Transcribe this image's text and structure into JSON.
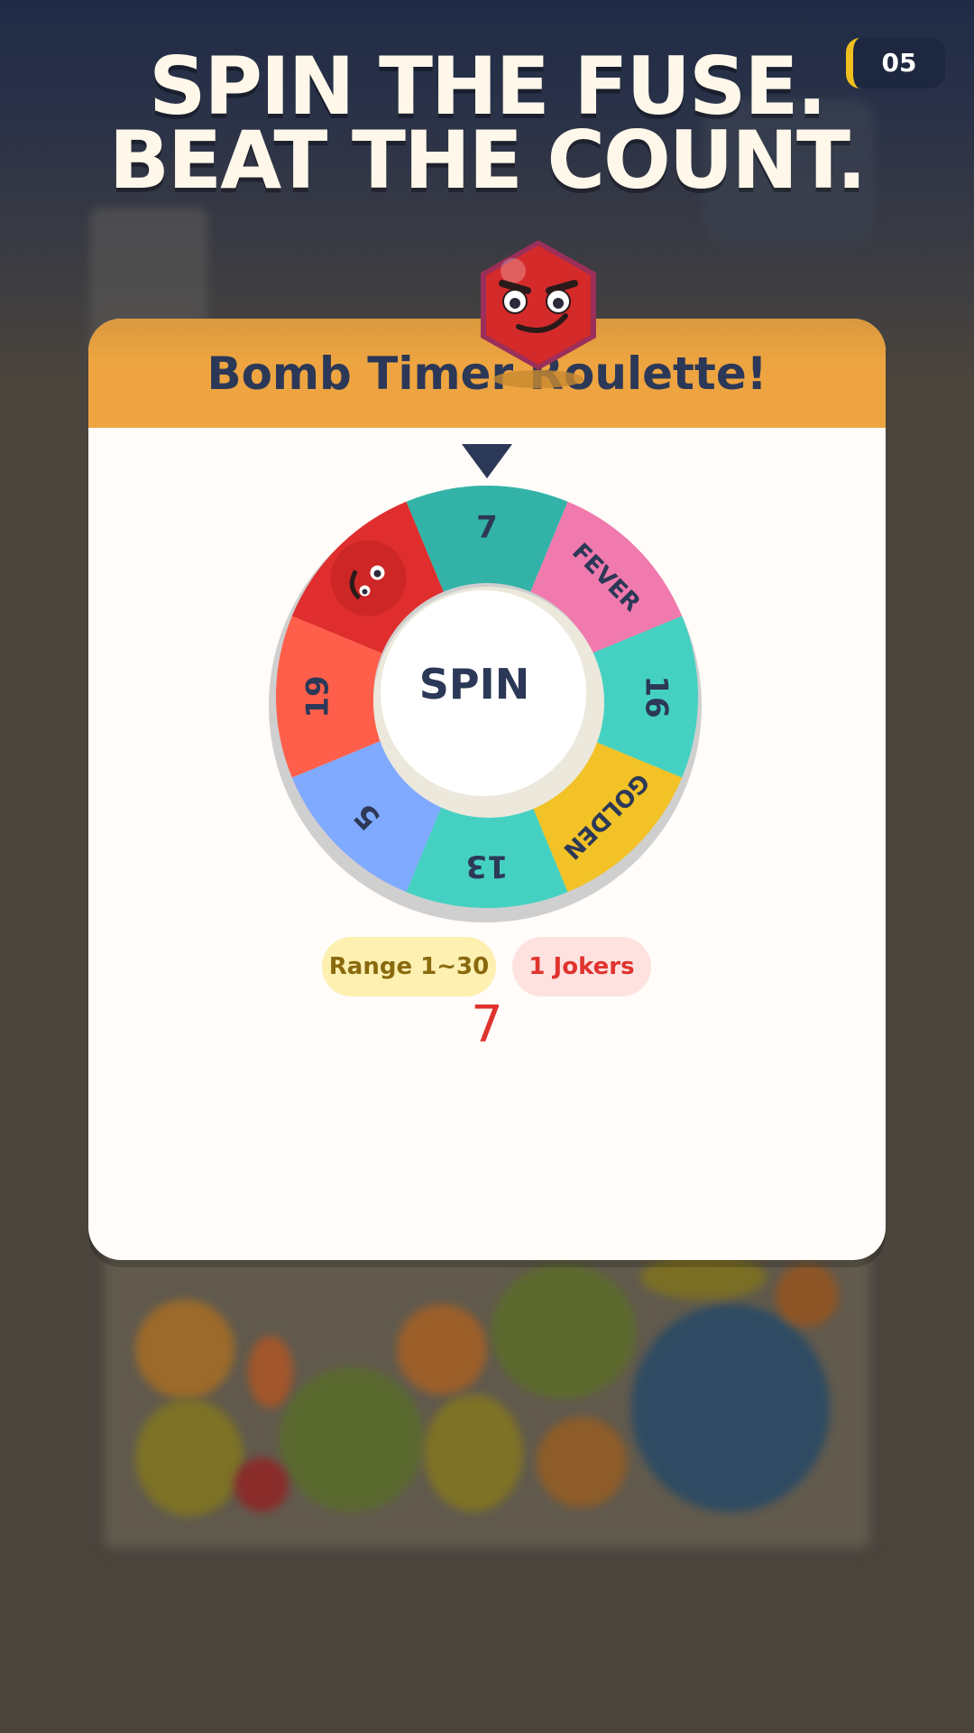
{
  "banner": {
    "line1": "SPIN THE FUSE.",
    "line2": "BEAT THE COUNT."
  },
  "level_badge": {
    "value": "05"
  },
  "modal": {
    "title": "Bomb Timer Roulette!"
  },
  "wheel": {
    "segments": [
      {
        "label": "7",
        "color": "#33b3a7"
      },
      {
        "label": "FEVER",
        "color": "#f07aad"
      },
      {
        "label": "16",
        "color": "#45d1c2"
      },
      {
        "label": "GOLDEN",
        "color": "#f2c226"
      },
      {
        "label": "13",
        "color": "#45d1c2"
      },
      {
        "label": "5",
        "color": "#7faaff"
      },
      {
        "label": "19",
        "color": "#ff5f4a"
      },
      {
        "label": "",
        "color": "#e02e2e",
        "icon": "bomb-face-icon"
      }
    ],
    "spin_label": "SPIN",
    "pointer_icon": "pointer-down-icon"
  },
  "badges": {
    "range": "Range 1~30",
    "jokers": "1 Jokers"
  },
  "result": {
    "value": "7"
  },
  "colors": {
    "header": "#eda441",
    "title_text": "#2c3857",
    "accent_red": "#e0332e",
    "badge_gold": "#f0c020"
  }
}
